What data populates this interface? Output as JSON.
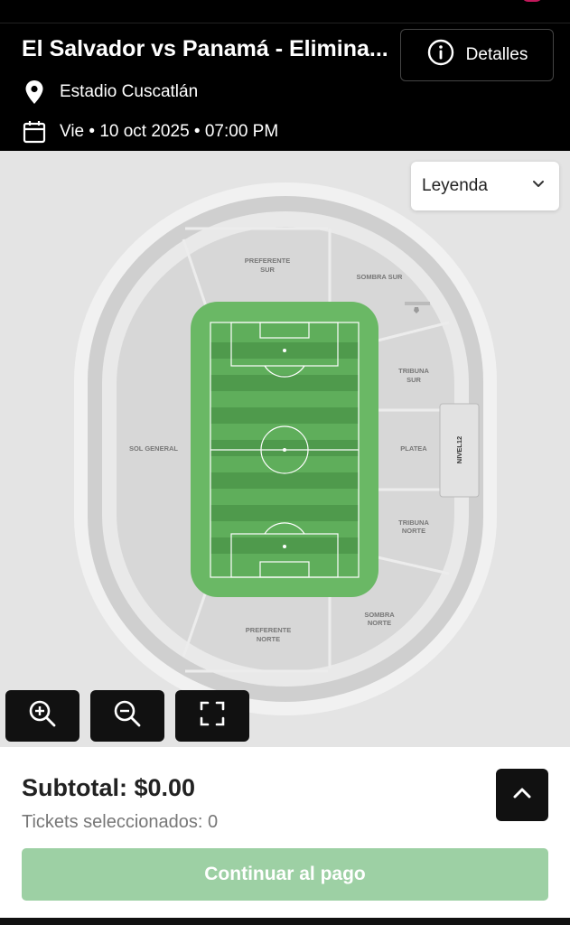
{
  "header": {
    "title": "El Salvador vs Panamá - Elimina...",
    "details_label": "Detalles",
    "venue": "Estadio Cuscatlán",
    "date": "Vie • 10 oct 2025 • 07:00 PM"
  },
  "map": {
    "legend_label": "Leyenda",
    "sections": {
      "preferente_sur_1": "PREFERENTE",
      "preferente_sur_2": "SUR",
      "sombra_sur": "SOMBRA SUR",
      "tribuna_sur_1": "TRIBUNA",
      "tribuna_sur_2": "SUR",
      "platea": "PLATEA",
      "nivel12": "NIVEL12",
      "tribuna_norte_1": "TRIBUNA",
      "tribuna_norte_2": "NORTE",
      "sombra_norte_1": "SOMBRA",
      "sombra_norte_2": "NORTE",
      "preferente_norte_1": "PREFERENTE",
      "preferente_norte_2": "NORTE",
      "sol_general": "SOL GENERAL"
    },
    "colors": {
      "field": "#5fae5b",
      "field_dark": "#4f9a4c",
      "section": "#d9d9d9",
      "ring": "#c9c9c9"
    }
  },
  "summary": {
    "subtotal": "Subtotal: $0.00",
    "tickets": "Tickets seleccionados: 0",
    "continue_label": "Continuar al pago"
  },
  "icons": {
    "details": "info-circle-icon",
    "venue": "location-pin-icon",
    "date": "calendar-icon",
    "legend": "chevron-down-icon",
    "zoom_in": "zoom-in-icon",
    "zoom_out": "zoom-out-icon",
    "fit": "fullscreen-icon",
    "expand": "chevron-up-icon"
  }
}
